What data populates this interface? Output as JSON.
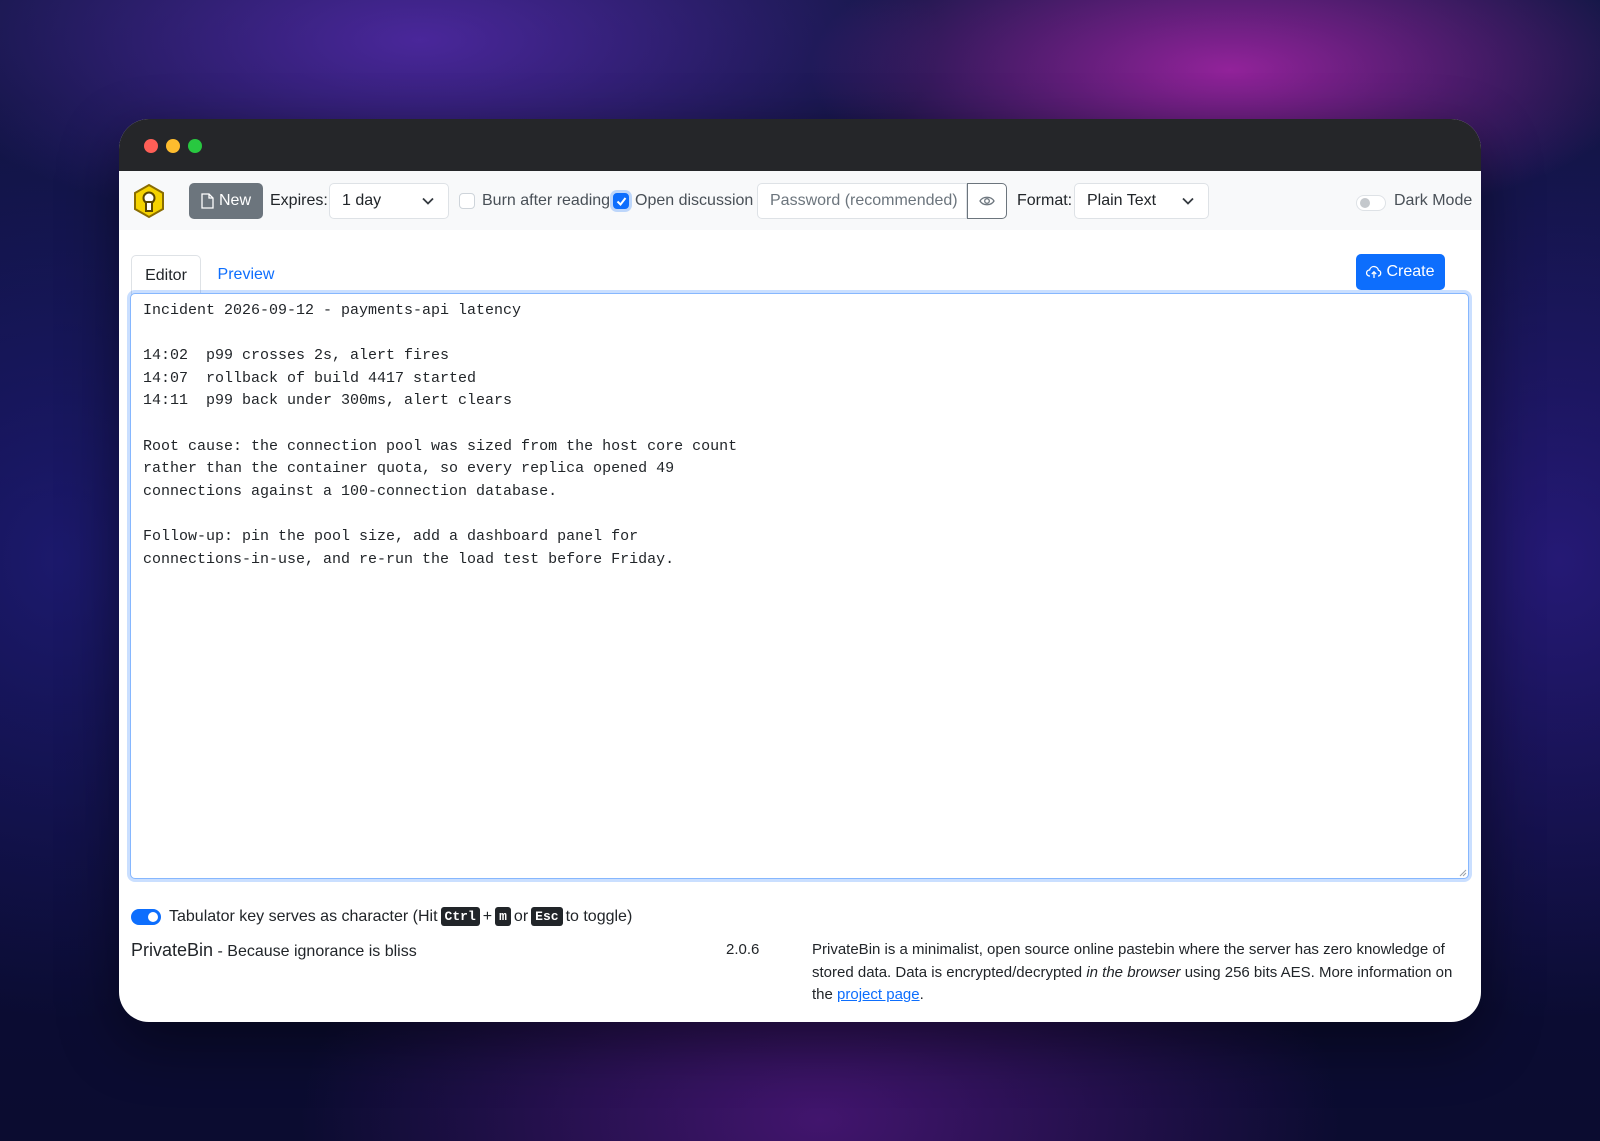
{
  "toolbar": {
    "new_label": "New",
    "expires_label": "Expires:",
    "expires_value": "1 day",
    "burn_label": "Burn after reading",
    "burn_checked": false,
    "discussion_label": "Open discussion",
    "discussion_checked": true,
    "password_placeholder": "Password (recommended)",
    "format_label": "Format:",
    "format_value": "Plain Text",
    "dark_mode_label": "Dark Mode",
    "dark_mode_on": false
  },
  "tabs": {
    "editor": "Editor",
    "preview": "Preview",
    "active": "Editor"
  },
  "create_label": "Create",
  "editor_text": "Incident 2026-09-12 - payments-api latency\n\n14:02  p99 crosses 2s, alert fires\n14:07  rollback of build 4417 started\n14:11  p99 back under 300ms, alert clears\n\nRoot cause: the connection pool was sized from the host core count\nrather than the container quota, so every replica opened 49\nconnections against a 100-connection database.\n\nFollow-up: pin the pool size, add a dashboard panel for\nconnections-in-use, and re-run the load test before Friday.",
  "tab_toggle": {
    "enabled": true,
    "before": "Tabulator key serves as character (Hit",
    "key1": "Ctrl",
    "plus": "+",
    "key2": "m",
    "or": "or",
    "key3": "Esc",
    "after": "to toggle)"
  },
  "footer": {
    "app_name": "PrivateBin",
    "tagline": " - Because ignorance is bliss",
    "version": "2.0.6",
    "about_1": "PrivateBin is a minimalist, open source online pastebin where the server has zero knowledge of stored data. Data is encrypted/decrypted ",
    "about_em": "in the browser",
    "about_2": " using 256 bits AES. More information on the ",
    "about_link": "project page",
    "about_end": "."
  },
  "colors": {
    "primary": "#0d6efd",
    "secondary": "#6c757d",
    "logo_yellow": "#f5d300",
    "titlebar": "#252629"
  },
  "icons": [
    "privatebin-logo-icon",
    "file-icon",
    "chevron-down-icon",
    "check-icon",
    "eye-icon",
    "cloud-upload-icon",
    "resize-grip-icon"
  ]
}
